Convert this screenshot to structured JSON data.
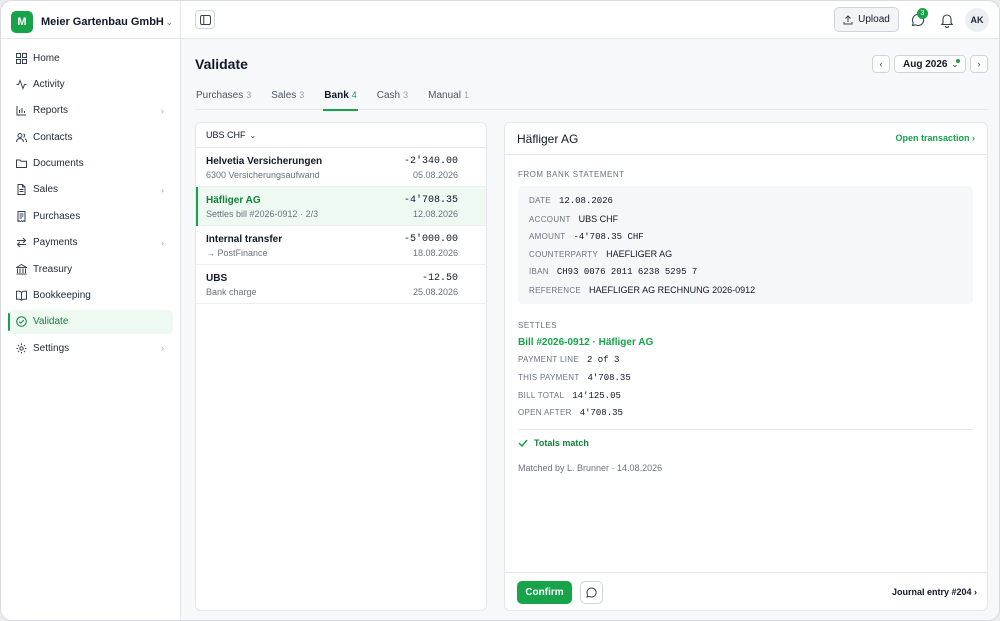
{
  "org": {
    "initial": "M",
    "name": "Meier Gartenbau GmbH"
  },
  "nav": [
    {
      "label": "Home",
      "icon": "grid-icon",
      "chevron": false
    },
    {
      "label": "Activity",
      "icon": "activity-icon",
      "chevron": false
    },
    {
      "label": "Reports",
      "icon": "bar-chart-icon",
      "chevron": true
    },
    {
      "label": "Contacts",
      "icon": "users-icon",
      "chevron": false
    },
    {
      "label": "Documents",
      "icon": "folder-icon",
      "chevron": false
    },
    {
      "label": "Sales",
      "icon": "file-icon",
      "chevron": true
    },
    {
      "label": "Purchases",
      "icon": "receipt-icon",
      "chevron": false
    },
    {
      "label": "Payments",
      "icon": "transfer-icon",
      "chevron": true
    },
    {
      "label": "Treasury",
      "icon": "bank-icon",
      "chevron": false
    },
    {
      "label": "Bookkeeping",
      "icon": "book-icon",
      "chevron": false
    },
    {
      "label": "Validate",
      "icon": "check-circle-icon",
      "chevron": false,
      "active": true
    },
    {
      "label": "Settings",
      "icon": "gear-icon",
      "chevron": true
    }
  ],
  "topbar": {
    "upload_label": "Upload",
    "chat_badge": "3",
    "avatar": "AK"
  },
  "page": {
    "title": "Validate",
    "period": "Aug 2026"
  },
  "tabs": [
    {
      "label": "Purchases",
      "count": "3"
    },
    {
      "label": "Sales",
      "count": "3"
    },
    {
      "label": "Bank",
      "count": "4",
      "active": true
    },
    {
      "label": "Cash",
      "count": "3"
    },
    {
      "label": "Manual",
      "count": "1"
    }
  ],
  "list": {
    "account": "UBS CHF",
    "rows": [
      {
        "name": "Helvetia Versicherungen",
        "sub": "6300 Versicherungsaufwand",
        "amount": "-2'340.00",
        "date": "05.08.2026"
      },
      {
        "name": "Häfliger AG",
        "sub": "Settles bill #2026-0912 · 2/3",
        "amount": "-4'708.35",
        "date": "12.08.2026",
        "selected": true
      },
      {
        "name": "Internal transfer",
        "sub": "→ PostFinance",
        "amount": "-5'000.00",
        "date": "18.08.2026"
      },
      {
        "name": "UBS",
        "sub": "Bank charge",
        "amount": "-12.50",
        "date": "25.08.2026"
      }
    ]
  },
  "detail": {
    "title": "Häfliger AG",
    "open_link": "Open transaction ›",
    "from_label": "FROM BANK STATEMENT",
    "statement": [
      {
        "key": "DATE",
        "value": "12.08.2026"
      },
      {
        "key": "ACCOUNT",
        "value": "UBS CHF",
        "sans": true
      },
      {
        "key": "AMOUNT",
        "value": "-4'708.35 CHF"
      },
      {
        "key": "COUNTERPARTY",
        "value": "HAEFLIGER AG",
        "sans": true
      },
      {
        "key": "IBAN",
        "value": "CH93 0076 2011 6238 5295 7"
      },
      {
        "key": "REFERENCE",
        "value": "HAEFLIGER AG RECHNUNG 2026-0912",
        "sans": true
      }
    ],
    "settles_label": "SETTLES",
    "bill_link": "Bill #2026-0912 · Häfliger AG",
    "settles": [
      {
        "key": "PAYMENT LINE",
        "value": "2 of 3"
      },
      {
        "key": "THIS PAYMENT",
        "value": "4'708.35"
      },
      {
        "key": "BILL TOTAL",
        "value": "14'125.05"
      },
      {
        "key": "OPEN AFTER",
        "value": "4'708.35"
      }
    ],
    "match_status": "Totals match",
    "matched_by": "Matched by L. Brunner · 14.08.2026",
    "confirm_label": "Confirm",
    "journal_link": "Journal entry #204 ›"
  },
  "colors": {
    "accent": "#16a34a",
    "accent_bg": "#eef9f1"
  }
}
